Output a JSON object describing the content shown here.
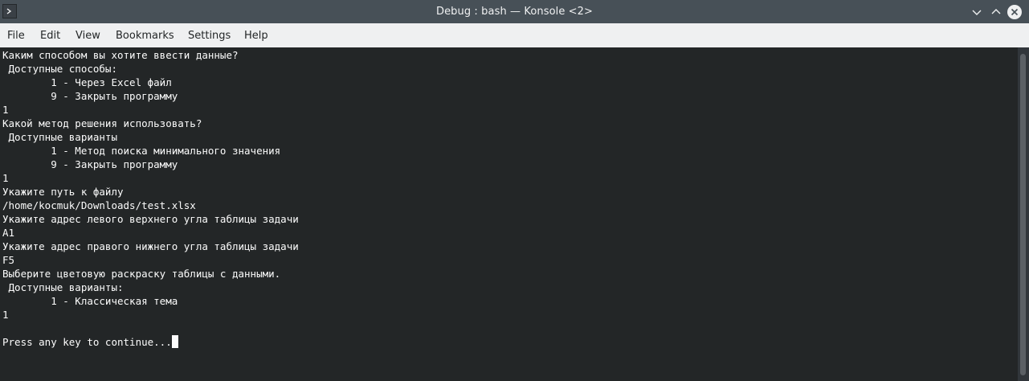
{
  "window": {
    "title": "Debug : bash — Konsole <2>"
  },
  "menu": {
    "items": [
      "File",
      "Edit",
      "View",
      "Bookmarks",
      "Settings",
      "Help"
    ]
  },
  "terminal": {
    "lines": [
      "Каким способом вы хотите ввести данные?",
      " Доступные способы:",
      "        1 - Через Excel файл",
      "        9 - Закрыть программу",
      "1",
      "Какой метод решения использовать?",
      " Доступные варианты",
      "        1 - Метод поиска минимального значения",
      "        9 - Закрыть программу",
      "1",
      "Укажите путь к файлу",
      "/home/kocmuk/Downloads/test.xlsx",
      "Укажите адрес левого верхнего угла таблицы задачи",
      "A1",
      "Укажите адрес правого нижнего угла таблицы задачи",
      "F5",
      "Выберите цветовую раскраску таблицы с данными.",
      " Доступные варианты:",
      "        1 - Классическая тема",
      "1",
      "",
      "Press any key to continue..."
    ]
  }
}
